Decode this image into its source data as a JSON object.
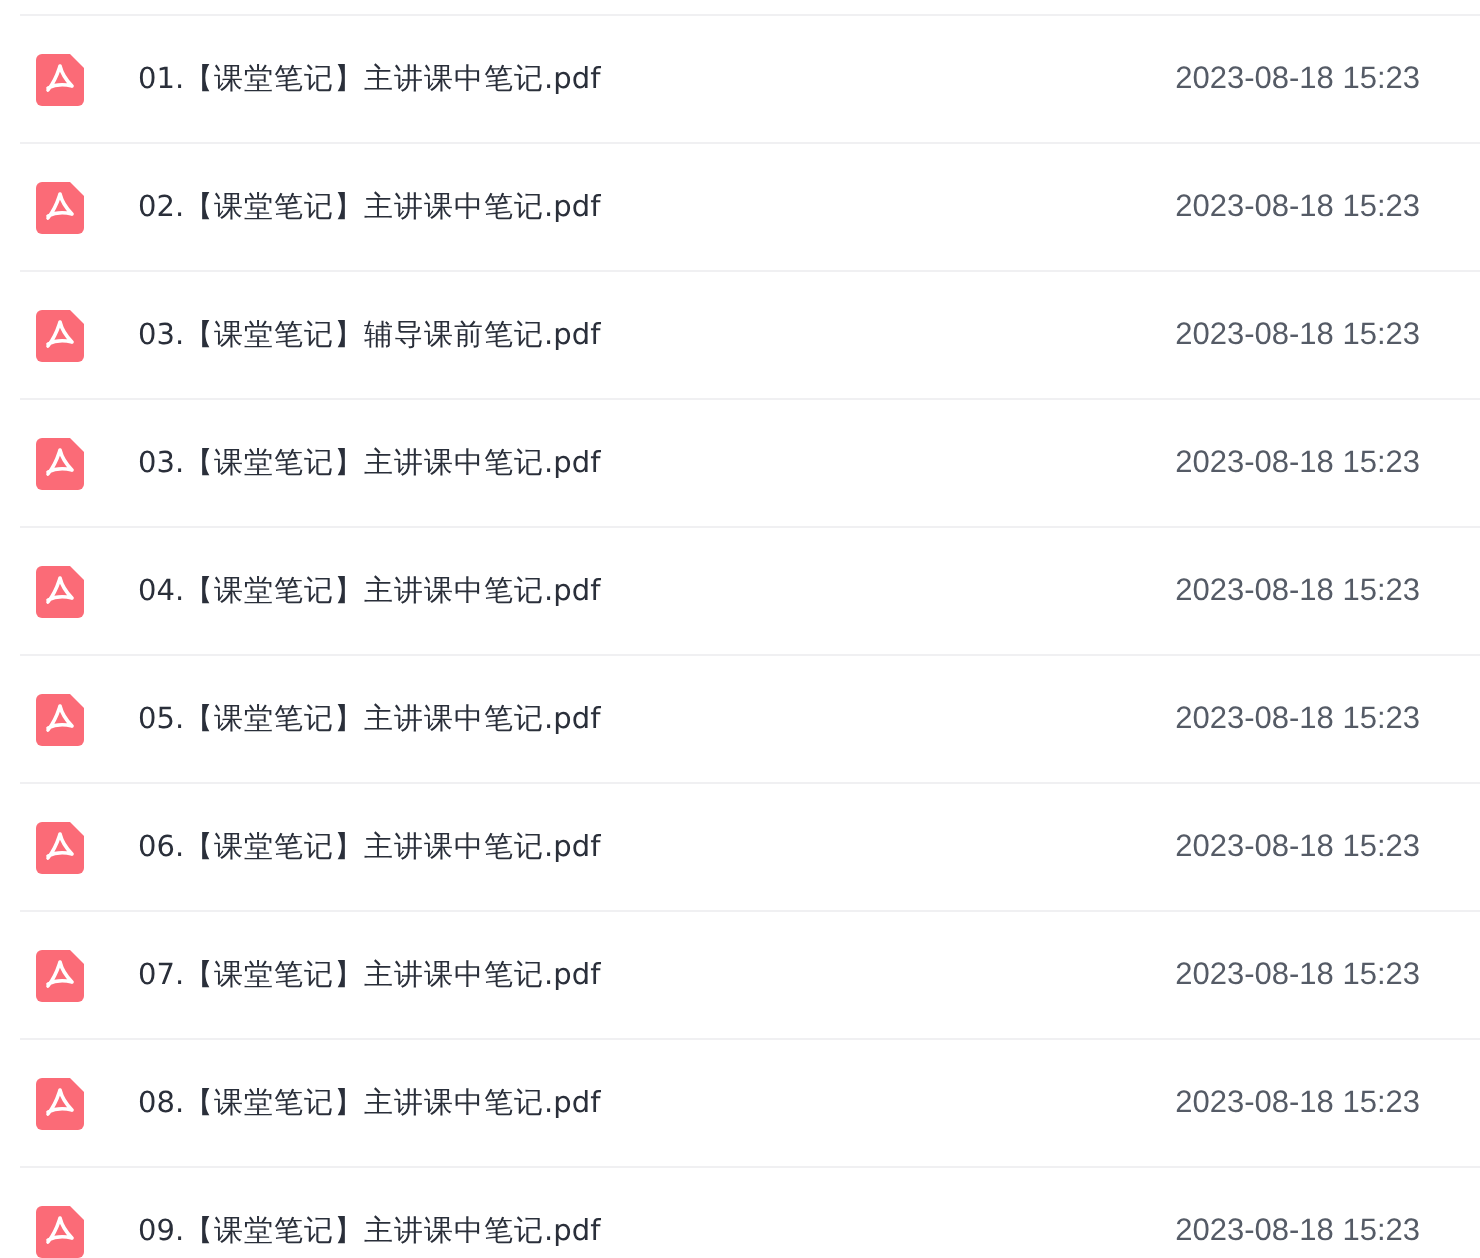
{
  "files": [
    {
      "name": "01.【课堂笔记】主讲课中笔记.pdf",
      "date": "2023-08-18 15:23"
    },
    {
      "name": "02.【课堂笔记】主讲课中笔记.pdf",
      "date": "2023-08-18 15:23"
    },
    {
      "name": "03.【课堂笔记】辅导课前笔记.pdf",
      "date": "2023-08-18 15:23"
    },
    {
      "name": "03.【课堂笔记】主讲课中笔记.pdf",
      "date": "2023-08-18 15:23"
    },
    {
      "name": "04.【课堂笔记】主讲课中笔记.pdf",
      "date": "2023-08-18 15:23"
    },
    {
      "name": "05.【课堂笔记】主讲课中笔记.pdf",
      "date": "2023-08-18 15:23"
    },
    {
      "name": "06.【课堂笔记】主讲课中笔记.pdf",
      "date": "2023-08-18 15:23"
    },
    {
      "name": "07.【课堂笔记】主讲课中笔记.pdf",
      "date": "2023-08-18 15:23"
    },
    {
      "name": "08.【课堂笔记】主讲课中笔记.pdf",
      "date": "2023-08-18 15:23"
    },
    {
      "name": "09.【课堂笔记】主讲课中笔记.pdf",
      "date": "2023-08-18 15:23"
    }
  ]
}
